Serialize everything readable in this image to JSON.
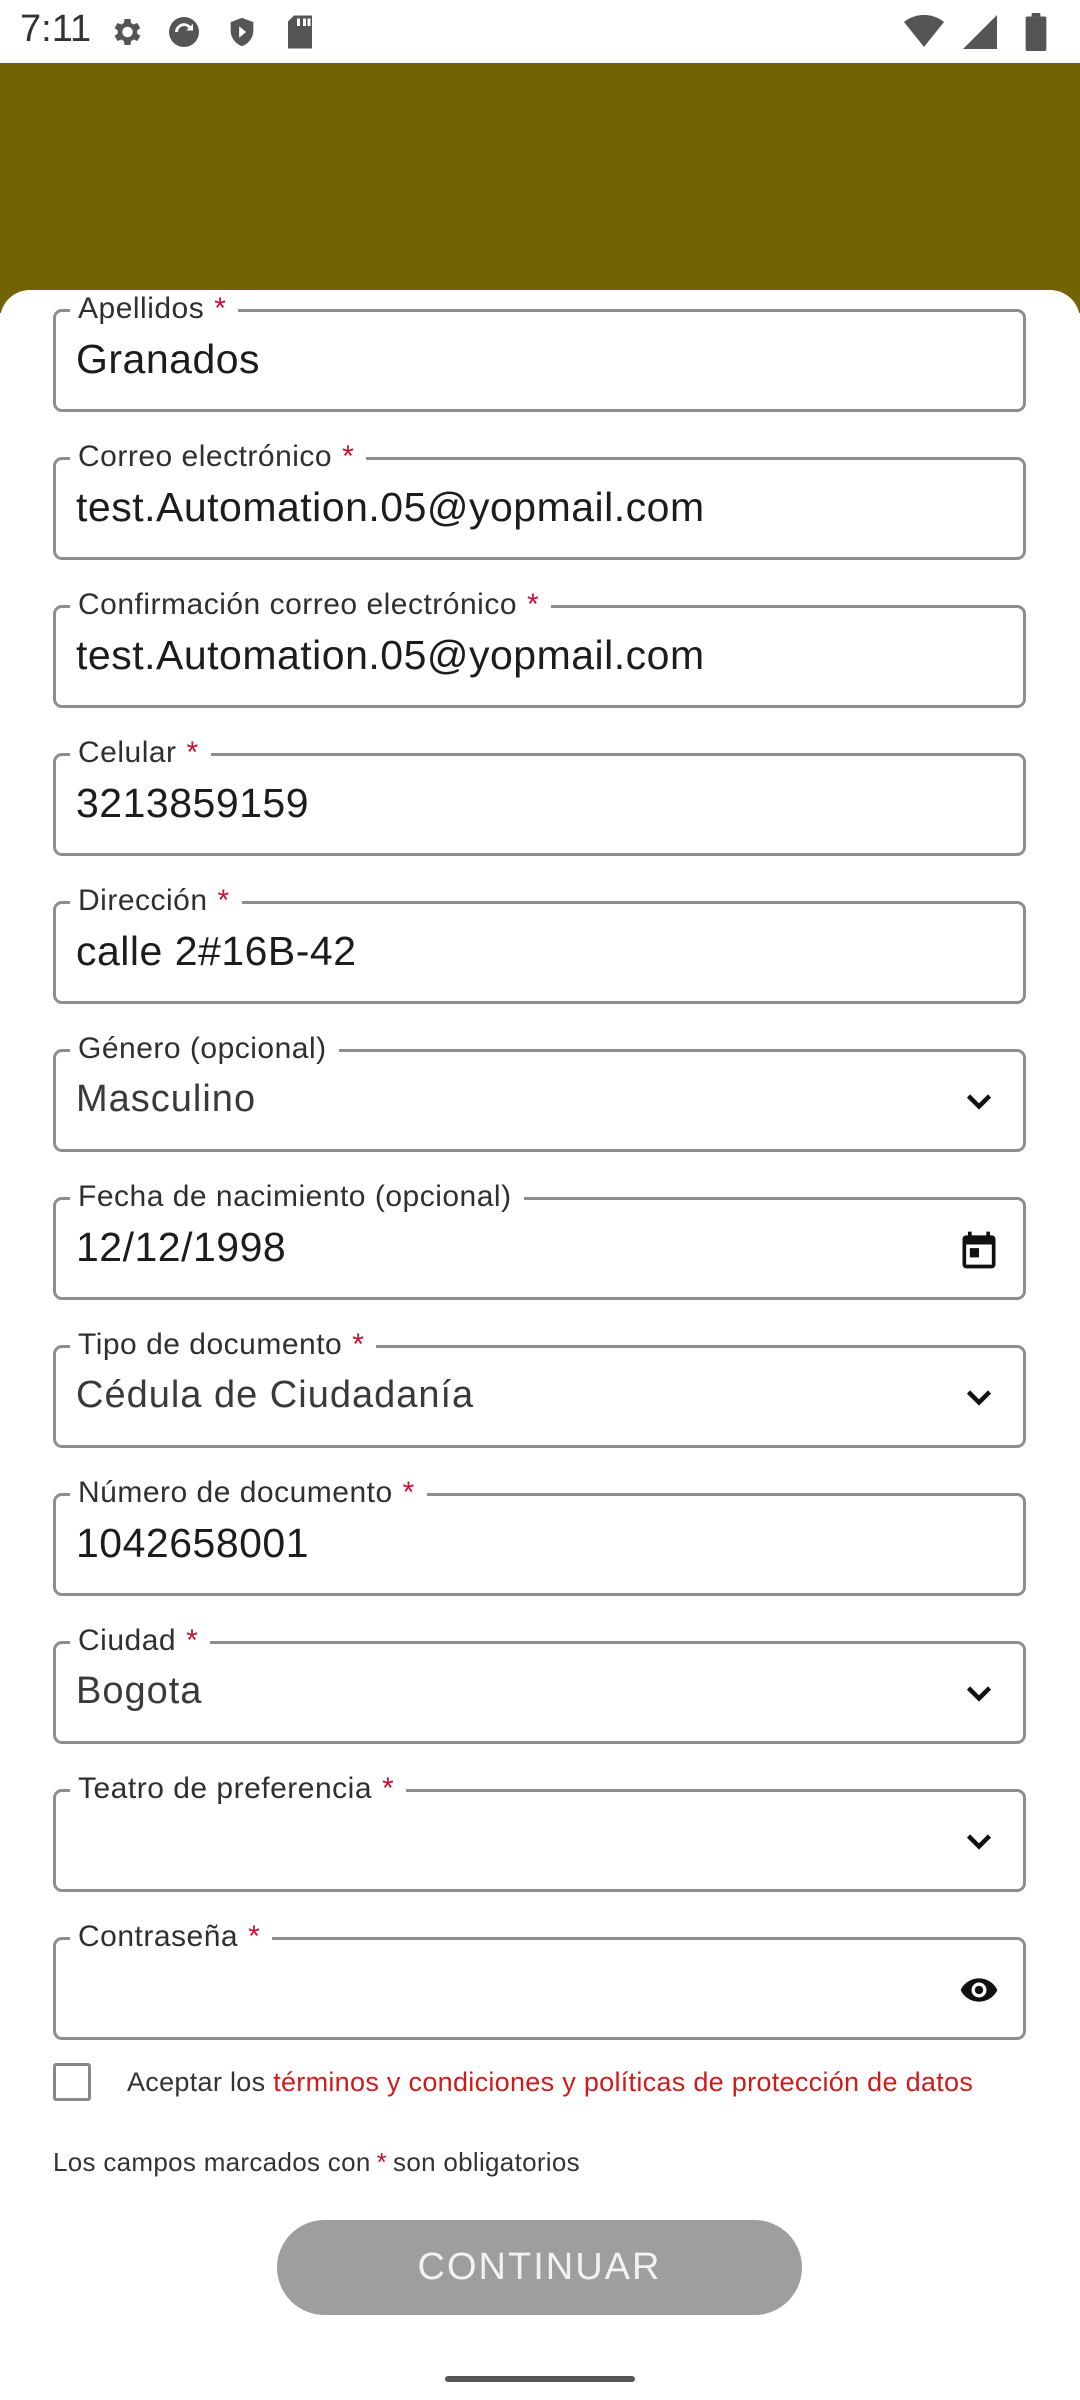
{
  "status_bar": {
    "time": "7:11",
    "icons_left": [
      "settings-icon",
      "sync-icon",
      "play-protect-icon",
      "sd-card-icon"
    ],
    "icons_right": [
      "wifi-icon",
      "signal-icon",
      "battery-icon"
    ]
  },
  "colors": {
    "header": "#746304",
    "required": "#c8102e",
    "link": "#d11a1a",
    "button_disabled": "#9e9e9e"
  },
  "form": {
    "apellidos": {
      "label": "Apellidos",
      "value": "Granados"
    },
    "correo": {
      "label": "Correo electrónico",
      "value": "test.Automation.05@yopmail.com"
    },
    "confirm_correo": {
      "label": "Confirmación correo electrónico",
      "value": "test.Automation.05@yopmail.com"
    },
    "celular": {
      "label": "Celular",
      "value": "3213859159"
    },
    "direccion": {
      "label": "Dirección",
      "value": "calle 2#16B-42"
    },
    "genero": {
      "label": "Género (opcional)",
      "value": "Masculino"
    },
    "fecha": {
      "label": "Fecha de nacimiento (opcional)",
      "value": "12/12/1998"
    },
    "tipo_doc": {
      "label": "Tipo de documento",
      "value": "Cédula de Ciudadanía"
    },
    "num_doc": {
      "label": "Número de documento",
      "value": "1042658001"
    },
    "ciudad": {
      "label": "Ciudad",
      "value": "Bogota"
    },
    "teatro": {
      "label": "Teatro de preferencia",
      "value": ""
    },
    "contrasena": {
      "label": "Contraseña",
      "value": ""
    },
    "required_mark": "*"
  },
  "terms": {
    "prefix": "Aceptar los",
    "link": "términos y condiciones y políticas de protección de datos"
  },
  "required_note": {
    "prefix": "Los campos marcados con",
    "mark": "*",
    "suffix": "son obligatorios"
  },
  "continue_label": "CONTINUAR"
}
